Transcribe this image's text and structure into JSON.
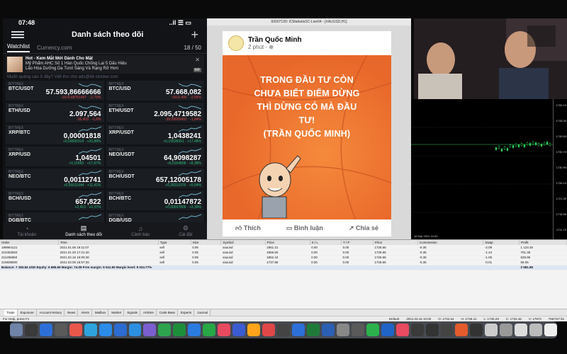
{
  "phone": {
    "time": "07:48",
    "signal": "..il ☰ ▭",
    "title": "Danh sách theo dõi",
    "tabs": {
      "watchlist": "Watchlist",
      "currency": "Currency.com",
      "count": "18 / 50"
    },
    "ad": {
      "title": "Hot - Kem Mắt Mới Dành Cho Mặt",
      "line2": "Mỹ Phẩm AHC Số 1 Hàn Quốc Chống Lại 5 Dấu Hiệu",
      "line3": "Lão Hóa Dưỡng Da Tươi Sáng Và Rạng Rỡ Hơn",
      "sponsor": "AHC Việt Nam",
      "badge": "Mở"
    },
    "notice": "Muốn quảng cáo ở đây? Viết thư cho ads@bit-stocker.com",
    "coins": [
      {
        "ex": "BITTREX",
        "pair": "BTC/USDT",
        "price": "57.593,86666666",
        "change": "-1614,68761497 · -2,73%",
        "dir": "down"
      },
      {
        "ex": "BITTREX",
        "pair": "BTC/USD",
        "price": "57.668,082",
        "change": "-1610,495 · -2,56%",
        "dir": "down"
      },
      {
        "ex": "BITTREX",
        "pair": "ETH/USD",
        "price": "2.097,564",
        "change": "-36,409 · -1,6%",
        "dir": "down"
      },
      {
        "ex": "BITTREX",
        "pair": "ETH/USDT",
        "price": "2.095,4719582",
        "change": "-38,09099492 · -1,84%",
        "dir": "down"
      },
      {
        "ex": "BITTREX",
        "pair": "XRP/BTC",
        "price": "0,00001818",
        "change": "+0,00000314 · +20,88%",
        "dir": "up"
      },
      {
        "ex": "BITTREX",
        "pair": "XRP/USDT",
        "price": "1,0438241",
        "change": "+0,15528351 · +17,48%",
        "dir": "up"
      },
      {
        "ex": "BITTREX",
        "pair": "XRP/USD",
        "price": "1,04501",
        "change": "+0,15693 · +17,67%",
        "dir": "up"
      },
      {
        "ex": "BITTREX",
        "pair": "NEO/USDT",
        "price": "64,9098287",
        "change": "+5,0164858 · +8,38%",
        "dir": "up"
      },
      {
        "ex": "BITTREX",
        "pair": "NEO/BTC",
        "price": "0,00112741",
        "change": "+0,00011644 · +11,41%",
        "dir": "up"
      },
      {
        "ex": "BITTREX",
        "pair": "BCH/USDT",
        "price": "657,12005178",
        "change": "+0,28210376 · +0,04%",
        "dir": "up"
      },
      {
        "ex": "BITTREX",
        "pair": "BCH/USD",
        "price": "657,822",
        "change": "+2,413 · +0,37%",
        "dir": "up"
      },
      {
        "ex": "BITTREX",
        "pair": "BCH/BTC",
        "price": "0,01147872",
        "change": "+0,00037809 · +3,39%",
        "dir": "up"
      },
      {
        "ex": "BITTREX",
        "pair": "DGB/BTC",
        "price": "",
        "change": "",
        "dir": "up"
      },
      {
        "ex": "BITTREX",
        "pair": "DGB/USD",
        "price": "",
        "change": "",
        "dir": "up"
      }
    ],
    "nav": [
      {
        "icon": "◔",
        "label": "Tài khoản"
      },
      {
        "icon": "▤",
        "label": "Danh sách theo dõi"
      },
      {
        "icon": "♫",
        "label": "Cảnh báo"
      },
      {
        "icon": "⚙",
        "label": "Cài đặt"
      }
    ]
  },
  "mt4": {
    "window_title": "60007130: ICMarketsSC-Live04 - [XAUUSD,H1]"
  },
  "fb": {
    "author": "Trần Quốc Minh",
    "time": "2 phút · ⊕",
    "quote": [
      "TRONG ĐẦU TƯ CÒN",
      "CHƯA BIẾT ĐIỂM DỪNG",
      "THÌ DỪNG CÓ MÀ ĐẦU",
      "TƯ!",
      "(TRẦN QUỐC MINH)"
    ],
    "like": "Thích",
    "comment": "Bình luận",
    "share": "Chia sẻ"
  },
  "scale_labels": [
    "1750.10",
    "1745.30",
    "1740.50",
    "1735.70",
    "1730.90",
    "1726.10",
    "1721.30",
    "1716.50",
    "1711.70"
  ],
  "chart_time": "16 Mar 2021 10:00",
  "terminal": {
    "headers": [
      "Order",
      "Time",
      "Type",
      "Size",
      "Symbol",
      "Price",
      "S / L",
      "T / P",
      "Price",
      "Commission",
      "Swap",
      "Profit"
    ],
    "rows": [
      [
        "199964121",
        "2021.01.06 19:11:07",
        "sell",
        "0.05",
        "xauusd",
        "1951.31",
        "0.00",
        "0.00",
        "1726.65",
        "-0.35",
        "-2.09",
        "1 123.30"
      ],
      [
        "210453503",
        "2021.01.20 17:21:40",
        "sell",
        "0.05",
        "xauusd",
        "1866.50",
        "0.00",
        "0.00",
        "1726.65",
        "-0.35",
        "-1.44",
        "701.35"
      ],
      [
        "211256850",
        "2021.02.16 16:00:40",
        "sell",
        "0.05",
        "xauusd",
        "1852.44",
        "0.00",
        "0.00",
        "1726.65",
        "-0.35",
        "-1.06",
        "628.95"
      ],
      [
        "215838600",
        "2021.03.05 16:57:26",
        "sell",
        "0.05",
        "xauusd",
        "1737.86",
        "0.00",
        "0.00",
        "1726.65",
        "-0.35",
        "-0.01",
        "56.05"
      ]
    ],
    "balance_text": "Balance: 7 183.84 USD  Equity: 6 685.69  Margin: 74.09  Free margin: 6 611.60  Margin level: 9 024.77%",
    "balance_profit": "2 581.85",
    "tabs": [
      "Trade",
      "Exposure",
      "Account History",
      "News",
      "Alerts",
      "Mailbox",
      "Market",
      "Signals",
      "Articles",
      "Code Base",
      "Experts",
      "Journal"
    ]
  },
  "statusbar": {
    "help": "For Help, press F1",
    "profile": "Default",
    "datetime": "2021.03.16 10:00",
    "o": "O: 1732.54",
    "h": "H: 1735.41",
    "l": "L: 1730.29",
    "c": "C: 1734.46",
    "v": "V: 17973",
    "traffic": "7967/27 kb"
  },
  "dock_colors": [
    "#6f84a8",
    "#3a3a3a",
    "#2d6fd8",
    "#5a5a5a",
    "#e8574a",
    "#2ea3de",
    "#2b8cea",
    "#2c6bd0",
    "#2d8fe0",
    "#7a5ed0",
    "#2ea44f",
    "#1d8f3a",
    "#2a7be0",
    "#28a745",
    "#e84a5f",
    "#3b5bd0",
    "#ffa41b",
    "#e04747",
    "#444",
    "#2d6fd8",
    "#1f7a3a",
    "#2b5fb3",
    "#888",
    "#5a5a5a",
    "#2bb24c",
    "#2064c8",
    "#e84a5f",
    "#3a3a3a",
    "#333",
    "#444",
    "#e55b2c",
    "#333",
    "#ccc",
    "#999",
    "#ddd",
    "#bbb",
    "#eee"
  ]
}
